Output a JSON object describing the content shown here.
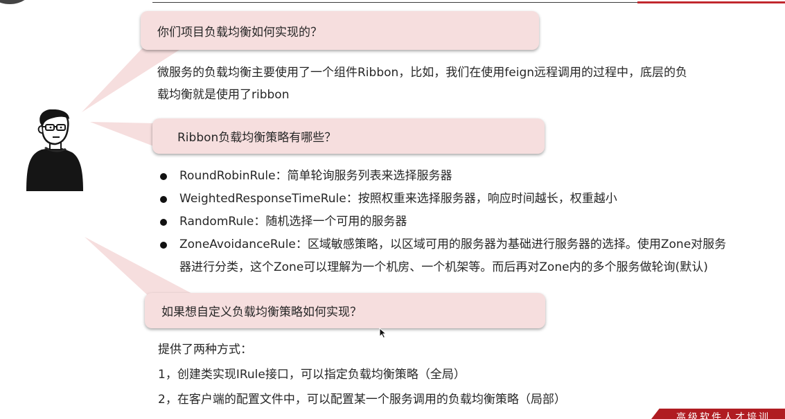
{
  "questions": [
    {
      "text": "你们项目负载均衡如何实现的？",
      "answer": [
        "微服务的负载均衡主要使用了一个组件Ribbon，比如，我们在使用feign远程调用的过程中，底层的负",
        "载均衡就是使用了ribbon"
      ]
    },
    {
      "text": "Ribbon负载均衡策略有哪些？",
      "bullets": [
        {
          "lines": [
            "RoundRobinRule：简单轮询服务列表来选择服务器"
          ]
        },
        {
          "lines": [
            "WeightedResponseTimeRule：按照权重来选择服务器，响应时间越长，权重越小"
          ]
        },
        {
          "lines": [
            "RandomRule：随机选择一个可用的服务器"
          ]
        },
        {
          "lines": [
            "ZoneAvoidanceRule：区域敏感策略，以区域可用的服务器为基础进行服务器的选择。使用Zone对服务",
            "器进行分类，这个Zone可以理解为一个机房、一个机架等。而后再对Zone内的多个服务做轮询(默认)"
          ]
        }
      ]
    },
    {
      "text": "如果想自定义负载均衡策略如何实现？",
      "answer_title": "提供了两种方式：",
      "answer_items": [
        "1，创建类实现IRule接口，可以指定负载均衡策略（全局）",
        "2，在客户端的配置文件中，可以配置某一个服务调用的负载均衡策略（局部）"
      ]
    }
  ],
  "watermark": "高级软件人才培训",
  "colors": {
    "bubble": "#f6dede",
    "text": "#262626",
    "accent_red": "#c1272d"
  },
  "icons": {
    "avatar": "person-with-glasses-avatar-icon",
    "cursor": "mouse-pointer-icon"
  }
}
